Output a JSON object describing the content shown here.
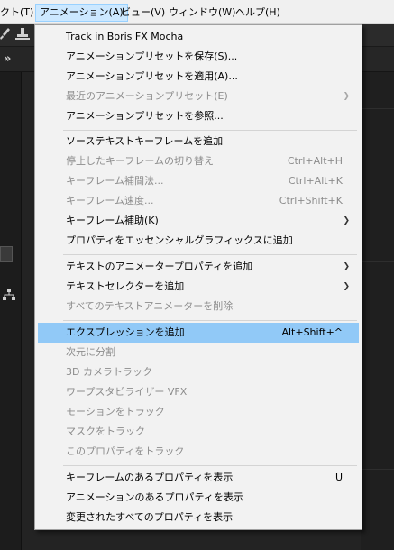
{
  "menubar": {
    "items": [
      {
        "label": "クト(T)"
      },
      {
        "label": "アニメーション(A)"
      },
      {
        "label": "ビュー(V)"
      },
      {
        "label": "ウィンドウ(W)"
      },
      {
        "label": "ヘルプ(H)"
      }
    ]
  },
  "menu": {
    "items": [
      {
        "label": "Track in Boris FX Mocha",
        "shortcut": "",
        "submenu": false,
        "disabled": false
      },
      {
        "label": "アニメーションプリセットを保存(S)...",
        "shortcut": "",
        "submenu": false,
        "disabled": false
      },
      {
        "label": "アニメーションプリセットを適用(A)...",
        "shortcut": "",
        "submenu": false,
        "disabled": false
      },
      {
        "label": "最近のアニメーションプリセット(E)",
        "shortcut": "",
        "submenu": true,
        "disabled": true
      },
      {
        "label": "アニメーションプリセットを参照...",
        "shortcut": "",
        "submenu": false,
        "disabled": false
      },
      {
        "label": "ソーステキストキーフレームを追加",
        "shortcut": "",
        "submenu": false,
        "disabled": false
      },
      {
        "label": "停止したキーフレームの切り替え",
        "shortcut": "Ctrl+Alt+H",
        "submenu": false,
        "disabled": true
      },
      {
        "label": "キーフレーム補間法...",
        "shortcut": "Ctrl+Alt+K",
        "submenu": false,
        "disabled": true
      },
      {
        "label": "キーフレーム速度...",
        "shortcut": "Ctrl+Shift+K",
        "submenu": false,
        "disabled": true
      },
      {
        "label": "キーフレーム補助(K)",
        "shortcut": "",
        "submenu": true,
        "disabled": false
      },
      {
        "label": "プロパティをエッセンシャルグラフィックスに追加",
        "shortcut": "",
        "submenu": false,
        "disabled": false
      },
      {
        "label": "テキストのアニメータープロパティを追加",
        "shortcut": "",
        "submenu": true,
        "disabled": false
      },
      {
        "label": "テキストセレクターを追加",
        "shortcut": "",
        "submenu": true,
        "disabled": false
      },
      {
        "label": "すべてのテキストアニメーターを削除",
        "shortcut": "",
        "submenu": false,
        "disabled": true
      },
      {
        "label": "エクスプレッションを追加",
        "shortcut": "Alt+Shift+^",
        "submenu": false,
        "disabled": false,
        "highlighted": true
      },
      {
        "label": "次元に分割",
        "shortcut": "",
        "submenu": false,
        "disabled": true
      },
      {
        "label": "3D カメラトラック",
        "shortcut": "",
        "submenu": false,
        "disabled": true
      },
      {
        "label": "ワープスタビライザー VFX",
        "shortcut": "",
        "submenu": false,
        "disabled": true
      },
      {
        "label": "モーションをトラック",
        "shortcut": "",
        "submenu": false,
        "disabled": true
      },
      {
        "label": "マスクをトラック",
        "shortcut": "",
        "submenu": false,
        "disabled": true
      },
      {
        "label": "このプロパティをトラック",
        "shortcut": "",
        "submenu": false,
        "disabled": true
      },
      {
        "label": "キーフレームのあるプロパティを表示",
        "shortcut": "U",
        "submenu": false,
        "disabled": false
      },
      {
        "label": "アニメーションのあるプロパティを表示",
        "shortcut": "",
        "submenu": false,
        "disabled": false
      },
      {
        "label": "変更されたすべてのプロパティを表示",
        "shortcut": "",
        "submenu": false,
        "disabled": false
      }
    ]
  },
  "icons": {
    "brush": "brush-icon",
    "stamp": "stamp-icon",
    "expand": "double-chevron-right-icon",
    "network": "network-icon",
    "submenu_arrow": "chevron-right-icon"
  },
  "colors": {
    "highlight": "#91c9f7",
    "disabled_text": "#8c8c8c",
    "menu_bg": "#f2f2f2",
    "menubar_active": "#cce8ff"
  }
}
